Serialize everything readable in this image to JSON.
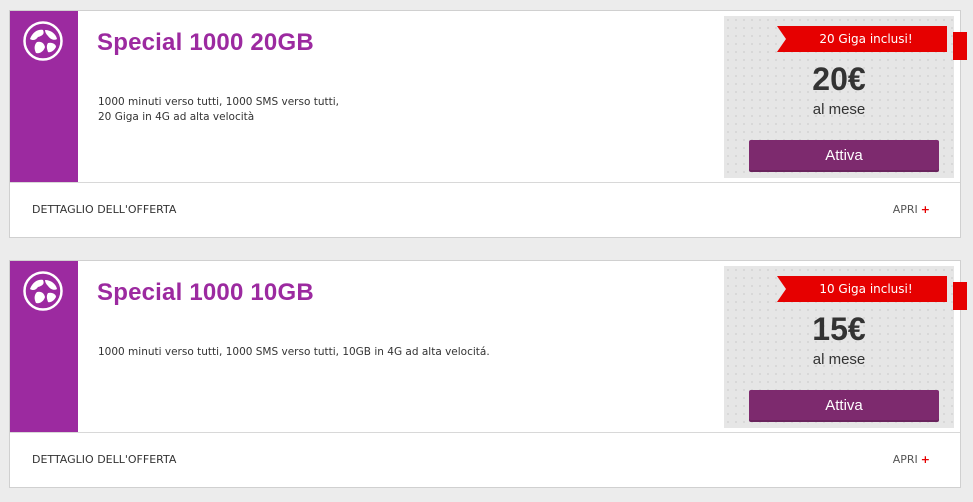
{
  "offers": [
    {
      "title": "Special 1000 20GB",
      "description_lines": [
        "1000 minuti verso tutti, 1000 SMS verso tutti,",
        "20 Giga in 4G ad alta velocità"
      ],
      "badge": "20 Giga inclusi!",
      "price": "20€",
      "period": "al mese",
      "cta": "Attiva",
      "details_label": "DETTAGLIO DELL'OFFERTA",
      "expand_label": "APRI",
      "expand_symbol": "+"
    },
    {
      "title": "Special 1000 10GB",
      "description_lines": [
        "1000 minuti verso tutti, 1000 SMS verso tutti, 10GB in 4G ad alta velocitá.",
        ""
      ],
      "badge": "10 Giga inclusi!",
      "price": "15€",
      "period": "al mese",
      "cta": "Attiva",
      "details_label": "DETTAGLIO DELL'OFFERTA",
      "expand_label": "APRI",
      "expand_symbol": "+"
    }
  ],
  "colors": {
    "brand_purple": "#9c2aa0",
    "button": "#7d2a6e",
    "ribbon_red": "#e60000",
    "background": "#ececec"
  },
  "icons": [
    "globe-icon"
  ]
}
